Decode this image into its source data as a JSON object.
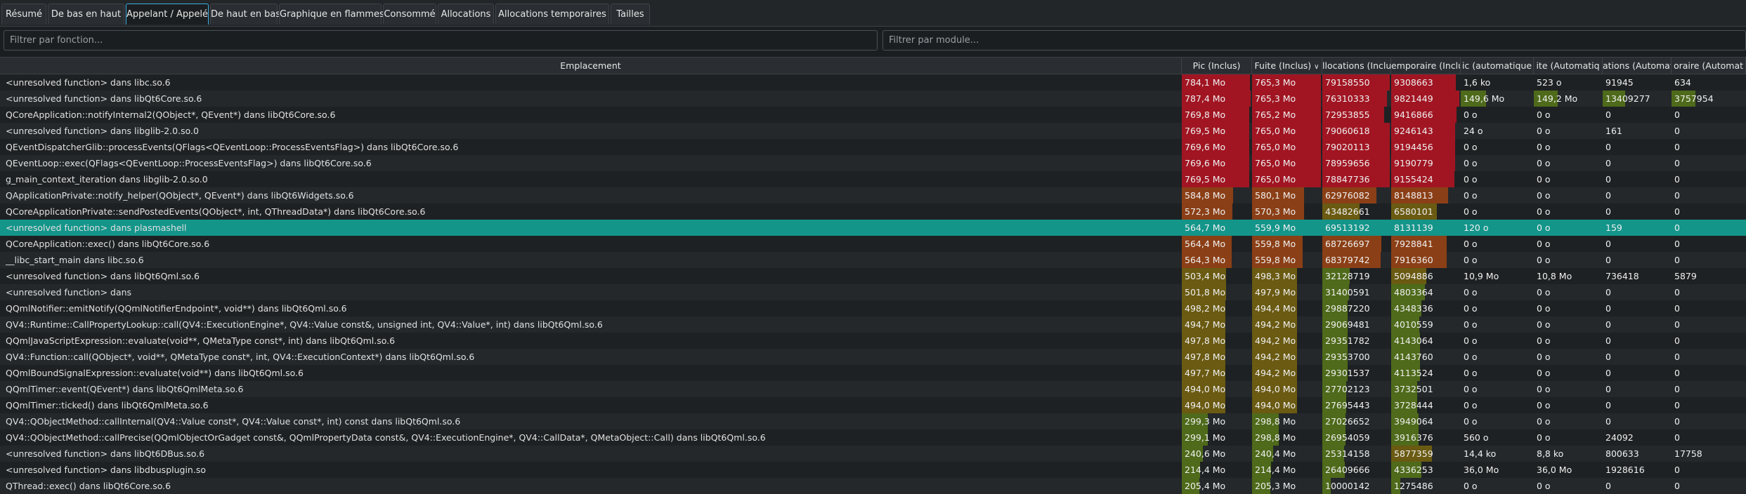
{
  "tabs": [
    {
      "label": "Résumé",
      "active": false
    },
    {
      "label": "De bas en haut",
      "active": false
    },
    {
      "label": "Appelant / Appelé",
      "active": true
    },
    {
      "label": "De haut en bas",
      "active": false
    },
    {
      "label": "Graphique en flammes",
      "active": false
    },
    {
      "label": "Consommé",
      "active": false
    },
    {
      "label": "Allocations",
      "active": false
    },
    {
      "label": "Allocations temporaires",
      "active": false
    },
    {
      "label": "Tailles",
      "active": false
    }
  ],
  "filters": {
    "function_placeholder": "Filtrer par fonction...",
    "module_placeholder": "Filtrer par module..."
  },
  "columns": [
    {
      "label": "Emplacement"
    },
    {
      "label": "Pic (Inclus)"
    },
    {
      "label": "Fuite (Inclus)",
      "sorted": "descending"
    },
    {
      "label": "llocations (Inclu"
    },
    {
      "label": "emporaire (Inclu"
    },
    {
      "label": "ic (automatique"
    },
    {
      "label": "ite (Automatiq"
    },
    {
      "label": "ations (Automat"
    },
    {
      "label": "oraire (Automat"
    }
  ],
  "colors": {
    "selected_row": "#13958a",
    "bar_high": "#a11522",
    "bar_mid": "#8b3f16",
    "bar_low": "#6a5a12",
    "bar_green": "#4e6a1a"
  },
  "rows": [
    {
      "loc": "<unresolved function> dans libc.so.6",
      "vals": [
        "784,1 Mo",
        "765,3 Mo",
        "79158550",
        "9308663",
        "1,6 ko",
        "523 o",
        "91945",
        "634"
      ],
      "f": [
        0.99,
        1.0,
        1.0,
        0.95,
        0,
        0,
        0,
        0
      ]
    },
    {
      "loc": "<unresolved function> dans libQt6Core.so.6",
      "vals": [
        "787,4 Mo",
        "765,3 Mo",
        "76310333",
        "9821449",
        "149,6 Mo",
        "149,2 Mo",
        "13409277",
        "3757954"
      ],
      "f": [
        1.0,
        1.0,
        0.96,
        1.0,
        0.35,
        0.35,
        0.33,
        0.33
      ]
    },
    {
      "loc": "QCoreApplication::notifyInternal2(QObject*, QEvent*) dans libQt6Core.so.6",
      "vals": [
        "769,8 Mo",
        "765,2 Mo",
        "72953855",
        "9416866",
        "0 o",
        "0 o",
        "0",
        "0"
      ],
      "f": [
        0.98,
        1.0,
        0.92,
        0.96,
        0,
        0,
        0,
        0
      ]
    },
    {
      "loc": "<unresolved function> dans libglib-2.0.so.0",
      "vals": [
        "769,5 Mo",
        "765,0 Mo",
        "79060618",
        "9246143",
        "24 o",
        "0 o",
        "161",
        "0"
      ],
      "f": [
        0.98,
        1.0,
        1.0,
        0.94,
        0,
        0,
        0,
        0
      ]
    },
    {
      "loc": "QEventDispatcherGlib::processEvents(QFlags<QEventLoop::ProcessEventsFlag>) dans libQt6Core.so.6",
      "vals": [
        "769,6 Mo",
        "765,0 Mo",
        "79020113",
        "9194456",
        "0 o",
        "0 o",
        "0",
        "0"
      ],
      "f": [
        0.98,
        1.0,
        1.0,
        0.94,
        0,
        0,
        0,
        0
      ]
    },
    {
      "loc": "QEventLoop::exec(QFlags<QEventLoop::ProcessEventsFlag>) dans libQt6Core.so.6",
      "vals": [
        "769,6 Mo",
        "765,0 Mo",
        "78959656",
        "9190779",
        "0 o",
        "0 o",
        "0",
        "0"
      ],
      "f": [
        0.98,
        1.0,
        1.0,
        0.94,
        0,
        0,
        0,
        0
      ]
    },
    {
      "loc": "g_main_context_iteration dans libglib-2.0.so.0",
      "vals": [
        "769,5 Mo",
        "765,0 Mo",
        "78847736",
        "9155424",
        "0 o",
        "0 o",
        "0",
        "0"
      ],
      "f": [
        0.98,
        1.0,
        1.0,
        0.93,
        0,
        0,
        0,
        0
      ]
    },
    {
      "loc": "QApplicationPrivate::notify_helper(QObject*, QEvent*) dans libQt6Widgets.so.6",
      "vals": [
        "584,8 Mo",
        "580,1 Mo",
        "62976082",
        "8148813",
        "0 o",
        "0 o",
        "0",
        "0"
      ],
      "f": [
        0.74,
        0.76,
        0.8,
        0.83,
        0,
        0,
        0,
        0
      ]
    },
    {
      "loc": "QCoreApplicationPrivate::sendPostedEvents(QObject*, int, QThreadData*) dans libQt6Core.so.6",
      "vals": [
        "572,3 Mo",
        "570,3 Mo",
        "43482661",
        "6580101",
        "0 o",
        "0 o",
        "0",
        "0"
      ],
      "f": [
        0.73,
        0.75,
        0.55,
        0.67,
        0,
        0,
        0,
        0
      ]
    },
    {
      "loc": "<unresolved function> dans plasmashell",
      "vals": [
        "564,7 Mo",
        "559,9 Mo",
        "69513192",
        "8131139",
        "120 o",
        "0 o",
        "159",
        "0"
      ],
      "f": [
        0.72,
        0.73,
        0.88,
        0.83,
        0,
        0,
        0,
        0
      ],
      "selected": true
    },
    {
      "loc": "QCoreApplication::exec() dans libQt6Core.so.6",
      "vals": [
        "564,4 Mo",
        "559,8 Mo",
        "68726697",
        "7928841",
        "0 o",
        "0 o",
        "0",
        "0"
      ],
      "f": [
        0.72,
        0.73,
        0.87,
        0.81,
        0,
        0,
        0,
        0
      ]
    },
    {
      "loc": "__libc_start_main dans libc.so.6",
      "vals": [
        "564,3 Mo",
        "559,8 Mo",
        "68379742",
        "7916360",
        "0 o",
        "0 o",
        "0",
        "0"
      ],
      "f": [
        0.72,
        0.73,
        0.86,
        0.81,
        0,
        0,
        0,
        0
      ]
    },
    {
      "loc": "<unresolved function> dans libQt6Qml.so.6",
      "vals": [
        "503,4 Mo",
        "498,3 Mo",
        "32128719",
        "5094886",
        "10,9 Mo",
        "10,8 Mo",
        "736418",
        "5879"
      ],
      "f": [
        0.64,
        0.65,
        0.41,
        0.52,
        0,
        0,
        0,
        0
      ]
    },
    {
      "loc": "<unresolved function> dans",
      "vals": [
        "501,8 Mo",
        "497,9 Mo",
        "31400591",
        "4803364",
        "0 o",
        "0 o",
        "0",
        "0"
      ],
      "f": [
        0.64,
        0.65,
        0.4,
        0.49,
        0,
        0,
        0,
        0
      ]
    },
    {
      "loc": "QQmlNotifier::emitNotify(QQmlNotifierEndpoint*, void**) dans libQt6Qml.so.6",
      "vals": [
        "498,2 Mo",
        "494,4 Mo",
        "29887220",
        "4348336",
        "0 o",
        "0 o",
        "0",
        "0"
      ],
      "f": [
        0.63,
        0.65,
        0.38,
        0.44,
        0,
        0,
        0,
        0
      ]
    },
    {
      "loc": "QV4::Runtime::CallPropertyLookup::call(QV4::ExecutionEngine*, QV4::Value const&, unsigned int, QV4::Value*, int) dans libQt6Qml.so.6",
      "vals": [
        "494,7 Mo",
        "494,2 Mo",
        "29069481",
        "4010559",
        "0 o",
        "0 o",
        "0",
        "0"
      ],
      "f": [
        0.63,
        0.65,
        0.37,
        0.41,
        0,
        0,
        0,
        0
      ]
    },
    {
      "loc": "QQmlJavaScriptExpression::evaluate(void**, QMetaType const*, int) dans libQt6Qml.so.6",
      "vals": [
        "497,8 Mo",
        "494,2 Mo",
        "29351782",
        "4143064",
        "0 o",
        "0 o",
        "0",
        "0"
      ],
      "f": [
        0.63,
        0.65,
        0.37,
        0.42,
        0,
        0,
        0,
        0
      ]
    },
    {
      "loc": "QV4::Function::call(QObject*, void**, QMetaType const*, int, QV4::ExecutionContext*) dans libQt6Qml.so.6",
      "vals": [
        "497,8 Mo",
        "494,2 Mo",
        "29353700",
        "4143760",
        "0 o",
        "0 o",
        "0",
        "0"
      ],
      "f": [
        0.63,
        0.65,
        0.37,
        0.42,
        0,
        0,
        0,
        0
      ]
    },
    {
      "loc": "QQmlBoundSignalExpression::evaluate(void**) dans libQt6Qml.so.6",
      "vals": [
        "497,7 Mo",
        "494,2 Mo",
        "29301537",
        "4113524",
        "0 o",
        "0 o",
        "0",
        "0"
      ],
      "f": [
        0.63,
        0.65,
        0.37,
        0.42,
        0,
        0,
        0,
        0
      ]
    },
    {
      "loc": "QQmlTimer::event(QEvent*) dans libQt6QmlMeta.so.6",
      "vals": [
        "494,0 Mo",
        "494,0 Mo",
        "27702123",
        "3732501",
        "0 o",
        "0 o",
        "0",
        "0"
      ],
      "f": [
        0.63,
        0.65,
        0.35,
        0.38,
        0,
        0,
        0,
        0
      ]
    },
    {
      "loc": "QQmlTimer::ticked() dans libQt6QmlMeta.so.6",
      "vals": [
        "494,0 Mo",
        "494,0 Mo",
        "27695443",
        "3728444",
        "0 o",
        "0 o",
        "0",
        "0"
      ],
      "f": [
        0.63,
        0.65,
        0.35,
        0.38,
        0,
        0,
        0,
        0
      ]
    },
    {
      "loc": "QV4::QObjectMethod::callInternal(QV4::Value const*, QV4::Value const*, int) const dans libQt6Qml.so.6",
      "vals": [
        "299,3 Mo",
        "298,8 Mo",
        "27026652",
        "3949064",
        "0 o",
        "0 o",
        "0",
        "0"
      ],
      "f": [
        0.38,
        0.39,
        0.34,
        0.4,
        0,
        0,
        0,
        0
      ]
    },
    {
      "loc": "QV4::QObjectMethod::callPrecise(QQmlObjectOrGadget const&, QQmlPropertyData const&, QV4::ExecutionEngine*, QV4::CallData*, QMetaObject::Call) dans libQt6Qml.so.6",
      "vals": [
        "299,1 Mo",
        "298,8 Mo",
        "26954059",
        "3916376",
        "560 o",
        "0 o",
        "24092",
        "0"
      ],
      "f": [
        0.38,
        0.39,
        0.34,
        0.4,
        0,
        0,
        0,
        0
      ]
    },
    {
      "loc": "<unresolved function> dans libQt6DBus.so.6",
      "vals": [
        "240,6 Mo",
        "240,4 Mo",
        "25314158",
        "5877359",
        "14,4 ko",
        "8,8 ko",
        "800633",
        "17758"
      ],
      "f": [
        0.31,
        0.31,
        0.32,
        0.6,
        0,
        0,
        0,
        0
      ]
    },
    {
      "loc": "<unresolved function> dans libdbusplugin.so",
      "vals": [
        "214,4 Mo",
        "214,4 Mo",
        "26409666",
        "4336253",
        "36,0 Mo",
        "36,0 Mo",
        "1928616",
        "0"
      ],
      "f": [
        0.27,
        0.28,
        0.33,
        0.44,
        0,
        0,
        0,
        0
      ]
    },
    {
      "loc": "QThread::exec() dans libQt6Core.so.6",
      "vals": [
        "205,4 Mo",
        "205,3 Mo",
        "10000142",
        "1275486",
        "0 o",
        "0 o",
        "0",
        "0"
      ],
      "f": [
        0.26,
        0.27,
        0.13,
        0.13,
        0,
        0,
        0,
        0
      ]
    }
  ]
}
